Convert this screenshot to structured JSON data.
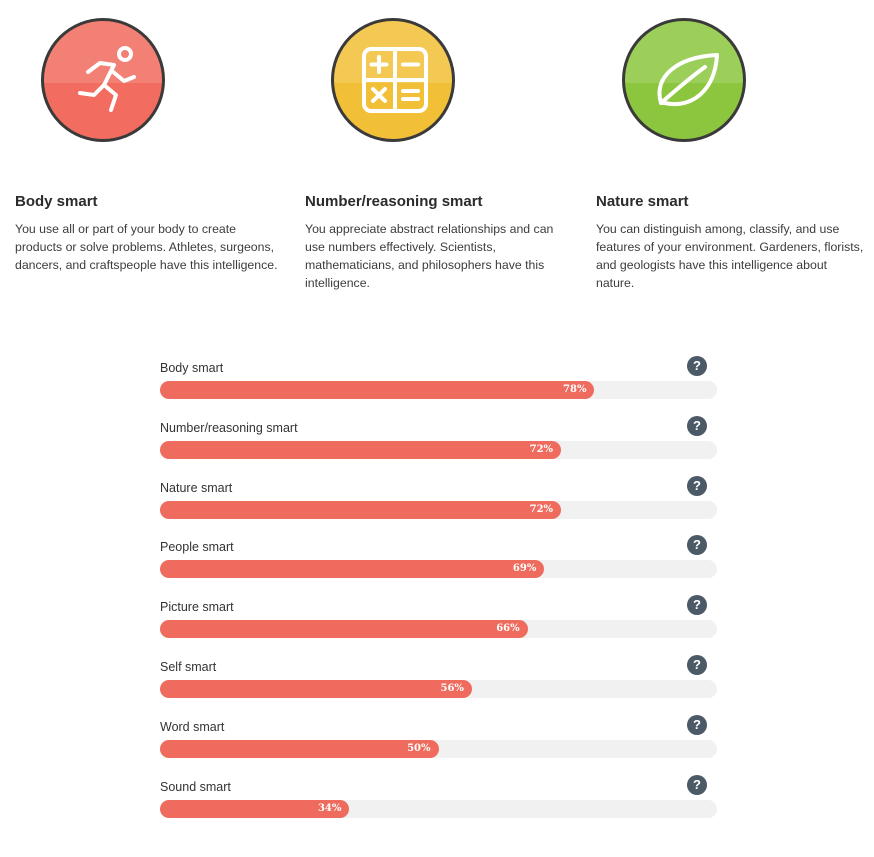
{
  "cards": [
    {
      "title": "Body smart",
      "description": "You use all or part of your body to create products or solve problems. Athletes, surgeons, dancers, and craftspeople have this intelligence.",
      "icon": "running-person-icon",
      "color": "#f26c5f"
    },
    {
      "title": "Number/reasoning smart",
      "description": "You appreciate abstract relationships and can use numbers effectively. Scientists, mathematicians, and philosophers have this intelligence.",
      "icon": "calculator-icon",
      "color": "#f2c037"
    },
    {
      "title": "Nature smart",
      "description": "You can distinguish among, classify, and use features of your environment. Gardeners, florists, and geologists have this intelligence about nature.",
      "icon": "leaf-icon",
      "color": "#8cc63f"
    }
  ],
  "help_glyph": "?",
  "chart_data": {
    "type": "bar",
    "orientation": "horizontal",
    "categories": [
      "Body smart",
      "Number/reasoning smart",
      "Nature smart",
      "People smart",
      "Picture smart",
      "Self smart",
      "Word smart",
      "Sound smart"
    ],
    "values": [
      78,
      72,
      72,
      69,
      66,
      56,
      50,
      34
    ],
    "value_labels": [
      "78%",
      "72%",
      "72%",
      "69%",
      "66%",
      "56%",
      "50%",
      "34%"
    ],
    "xlim": [
      0,
      100
    ],
    "bar_color": "#ee6b5e",
    "track_color": "#f1f1f1"
  }
}
